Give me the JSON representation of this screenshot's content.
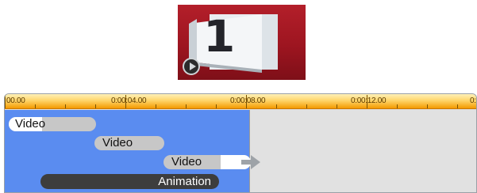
{
  "preview": {
    "number": "1",
    "play_icon": "play-circle-icon",
    "accent": "#b31f2a"
  },
  "timeline": {
    "ruler_labels": [
      "00.00",
      "0:00:04.00",
      "0:00:08.00",
      "0:00:12.00",
      "0:"
    ],
    "ruler_color": "#f39a00",
    "active_color": "#5a8cf0",
    "clips": [
      {
        "label": "Video"
      },
      {
        "label": "Video"
      },
      {
        "label": "Video"
      },
      {
        "label": "Animation"
      }
    ],
    "arrow_icon": "arrow-right-icon"
  }
}
